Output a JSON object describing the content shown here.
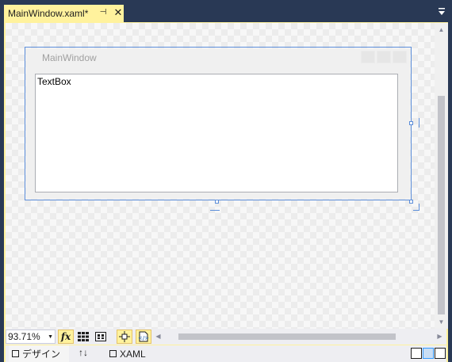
{
  "tab": {
    "title": "MainWindow.xaml*",
    "pin_glyph": "⊣",
    "close_glyph": "✕"
  },
  "designer": {
    "window_title": "MainWindow",
    "textbox_text": "TextBox"
  },
  "toolbar": {
    "zoom_value": "93.71%",
    "fx_label": "fx"
  },
  "panes": {
    "design_label": "デザイン",
    "swap_label": "↑↓",
    "xaml_label": "XAML"
  },
  "colors": {
    "tab_active": "#fff29d",
    "chrome": "#293955",
    "selection": "#5b8dd9"
  }
}
